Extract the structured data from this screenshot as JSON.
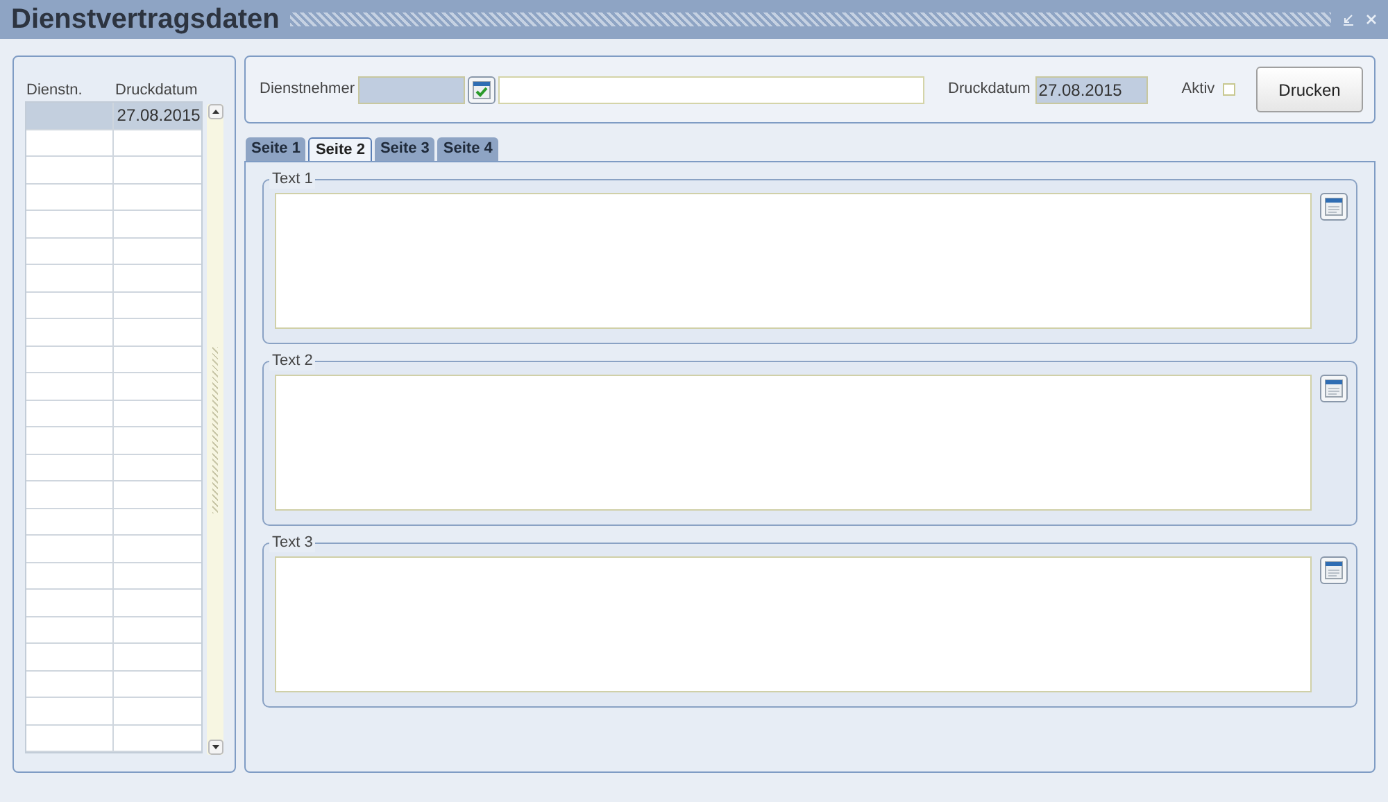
{
  "window": {
    "title": "Dienstvertragsdaten"
  },
  "list": {
    "columns": [
      "Dienstn.",
      "Druckdatum"
    ],
    "rows": [
      {
        "selected": true,
        "column_2": "27.08.2015"
      },
      {
        "selected": false
      },
      {
        "selected": false
      },
      {
        "selected": false
      },
      {
        "selected": false
      },
      {
        "selected": false
      },
      {
        "selected": false
      },
      {
        "selected": false
      },
      {
        "selected": false
      },
      {
        "selected": false
      },
      {
        "selected": false
      },
      {
        "selected": false
      },
      {
        "selected": false
      },
      {
        "selected": false
      },
      {
        "selected": false
      },
      {
        "selected": false
      },
      {
        "selected": false
      },
      {
        "selected": false
      },
      {
        "selected": false
      },
      {
        "selected": false
      },
      {
        "selected": false
      },
      {
        "selected": false
      },
      {
        "selected": false
      },
      {
        "selected": false
      }
    ]
  },
  "header": {
    "dienstnehmer_label": "Dienstnehmer",
    "druckdatum_label": "Druckdatum",
    "druckdatum_value": "27.08.2015",
    "aktiv_label": "Aktiv",
    "aktiv_checked": false,
    "print_button": "Drucken"
  },
  "tabs": [
    {
      "label": "Seite 1",
      "selected": false
    },
    {
      "label": "Seite 2",
      "selected": true
    },
    {
      "label": "Seite 3",
      "selected": false
    },
    {
      "label": "Seite 4",
      "selected": false
    }
  ],
  "groups": [
    {
      "label": "Text 1"
    },
    {
      "label": "Text 2"
    },
    {
      "label": "Text 3"
    }
  ]
}
